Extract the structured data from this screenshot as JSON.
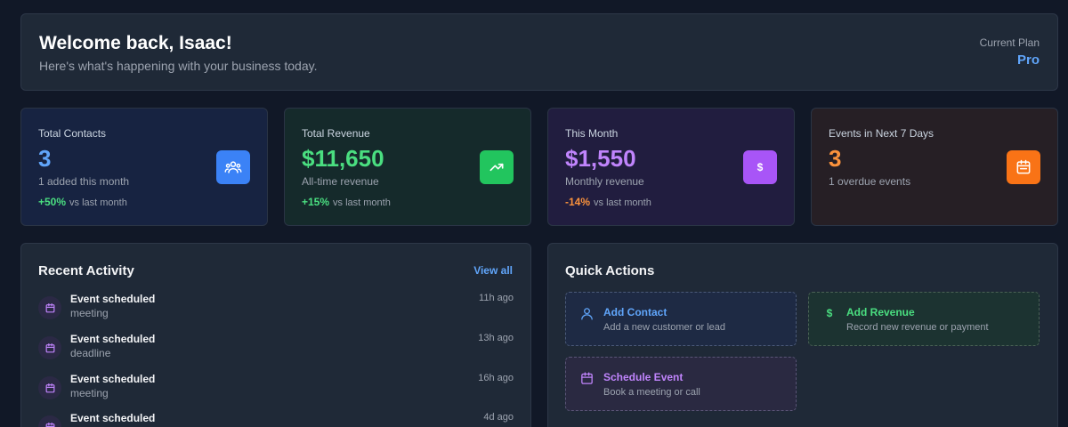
{
  "welcome": {
    "title": "Welcome back, Isaac!",
    "subtitle": "Here's what's happening with your business today.",
    "plan_label": "Current Plan",
    "plan_value": "Pro"
  },
  "stats": [
    {
      "label": "Total Contacts",
      "value": "3",
      "desc": "1 added this month",
      "trend_pct": "+50%",
      "trend_text": "vs last month",
      "icon": "users-icon",
      "accent": "#3b82f6"
    },
    {
      "label": "Total Revenue",
      "value": "$11,650",
      "desc": "All-time revenue",
      "trend_pct": "+15%",
      "trend_text": "vs last month",
      "icon": "trending-up-icon",
      "accent": "#22c55e"
    },
    {
      "label": "This Month",
      "value": "$1,550",
      "desc": "Monthly revenue",
      "trend_pct": "-14%",
      "trend_text": "vs last month",
      "icon": "dollar-icon",
      "accent": "#a855f7"
    },
    {
      "label": "Events in Next 7 Days",
      "value": "3",
      "desc": "1 overdue events",
      "icon": "calendar-icon",
      "accent": "#f97316"
    }
  ],
  "activity": {
    "title": "Recent Activity",
    "view_all": "View all",
    "items": [
      {
        "title": "Event scheduled",
        "sub": "meeting",
        "time": "11h ago"
      },
      {
        "title": "Event scheduled",
        "sub": "deadline",
        "time": "13h ago"
      },
      {
        "title": "Event scheduled",
        "sub": "meeting",
        "time": "16h ago"
      },
      {
        "title": "Event scheduled",
        "sub": "",
        "time": "4d ago"
      }
    ]
  },
  "quick": {
    "title": "Quick Actions",
    "actions": [
      {
        "title": "Add Contact",
        "desc": "Add a new customer or lead",
        "icon": "user-icon"
      },
      {
        "title": "Add Revenue",
        "desc": "Record new revenue or payment",
        "icon": "dollar-icon"
      },
      {
        "title": "Schedule Event",
        "desc": "Book a meeting or call",
        "icon": "calendar-icon"
      }
    ]
  }
}
